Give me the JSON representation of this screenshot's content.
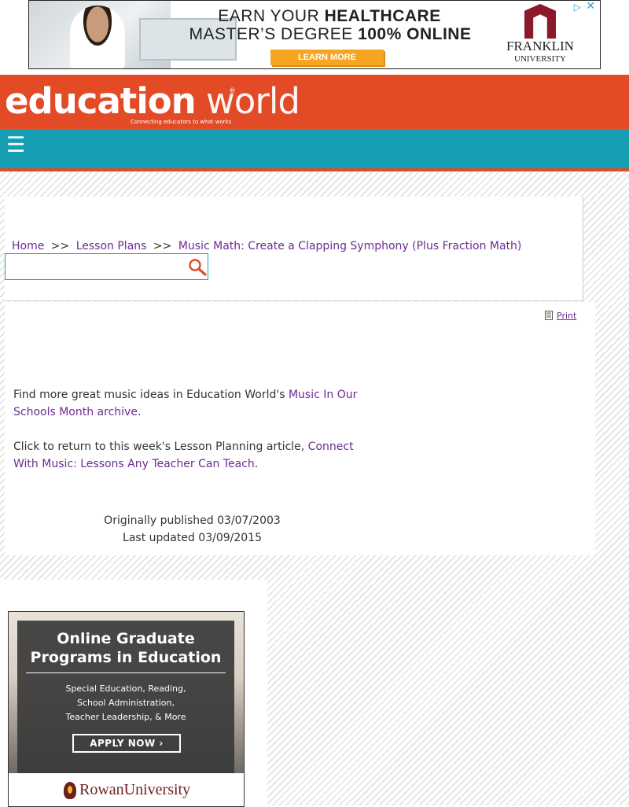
{
  "top_ad": {
    "headline_line1_plain": "EARN YOUR ",
    "headline_line1_bold": "HEALTHCARE",
    "headline_line2_plain": "MASTER’S DEGREE ",
    "headline_line2_bold": "100% ONLINE",
    "cta": "LEARN MORE",
    "logo_name": "FRANKLIN",
    "logo_sub": "UNIVERSITY",
    "adchoices_icon": "play-triangle-icon",
    "close_icon": "close-icon"
  },
  "header": {
    "logo_part1": "education",
    "logo_part2": " world",
    "logo_reg": "®",
    "tagline": "Connecting educators to what works",
    "menu_icon": "☰",
    "accent_color": "#e24b26",
    "nav_color": "#169fb3"
  },
  "breadcrumb": {
    "home": "Home",
    "sep": ">>",
    "lesson_plans": "Lesson Plans",
    "current": "Music Math: Create a Clapping Symphony (Plus Fraction Math)"
  },
  "search": {
    "value": "",
    "placeholder": ""
  },
  "print_label": "Print",
  "content": {
    "p1_text": "Find more great music ideas in Education World's ",
    "p1_link": "Music In Our Schools Month archive",
    "p1_end": ".",
    "p2_text": " Click to return to this week's Lesson Planning article, ",
    "p2_link": "Connect With Music: Lessons Any Teacher Can Teach",
    "p2_end": ".",
    "published": "Originally published 03/07/2003",
    "updated": "Last updated 03/09/2015"
  },
  "bottom_ad": {
    "title": "Online Graduate Programs in Education",
    "sub_line1": "Special Education, Reading,",
    "sub_line2": "School Administration,",
    "sub_line3": "Teacher Leadership, & More",
    "button": "APPLY NOW ›",
    "logo": "RowanUniversity"
  }
}
